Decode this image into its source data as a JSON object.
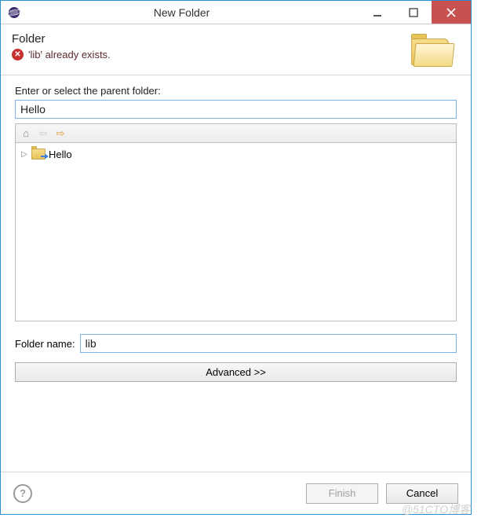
{
  "window": {
    "title": "New Folder"
  },
  "header": {
    "heading": "Folder",
    "error_message": "'lib' already exists."
  },
  "parent": {
    "label": "Enter or select the parent folder:",
    "value": "Hello"
  },
  "tree": {
    "items": [
      {
        "label": "Hello"
      }
    ]
  },
  "folder_name": {
    "label": "Folder name:",
    "value": "lib"
  },
  "buttons": {
    "advanced": "Advanced >>",
    "finish": "Finish",
    "cancel": "Cancel"
  },
  "watermark": "@51CTO博客"
}
